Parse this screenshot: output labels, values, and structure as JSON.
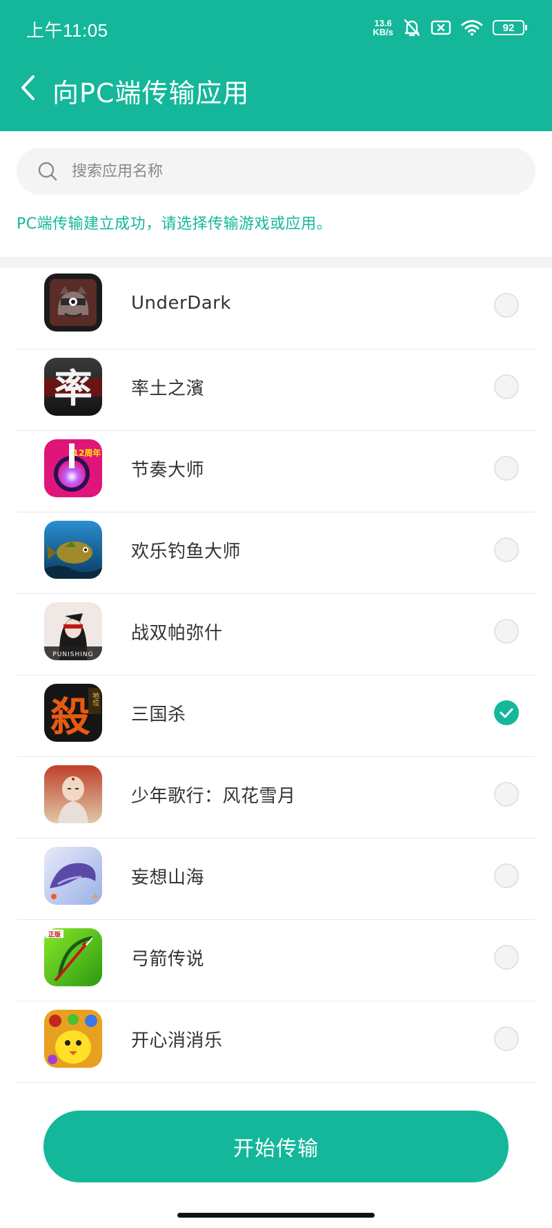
{
  "status": {
    "time": "上午11:05",
    "net_speed_value": "13.6",
    "net_speed_unit": "KB/s",
    "battery": "92"
  },
  "header": {
    "title": "向PC端传输应用"
  },
  "search": {
    "placeholder": "搜索应用名称"
  },
  "notice": "PC端传输建立成功，请选择传输游戏或应用。",
  "apps": [
    {
      "name": "UnderDark",
      "selected": false,
      "icon": "underdark-icon"
    },
    {
      "name": "率土之濱",
      "selected": false,
      "icon": "shuaitu-icon"
    },
    {
      "name": "节奏大师",
      "selected": false,
      "icon": "rhythm-master-icon"
    },
    {
      "name": "欢乐钓鱼大师",
      "selected": false,
      "icon": "fishing-icon"
    },
    {
      "name": "战双帕弥什",
      "selected": false,
      "icon": "punishing-icon"
    },
    {
      "name": "三国杀",
      "selected": true,
      "icon": "sanguosha-icon"
    },
    {
      "name": "少年歌行：风花雪月",
      "selected": false,
      "icon": "shaonian-icon"
    },
    {
      "name": "妄想山海",
      "selected": false,
      "icon": "wangxiang-icon"
    },
    {
      "name": "弓箭传说",
      "selected": false,
      "icon": "archero-icon"
    },
    {
      "name": "开心消消乐",
      "selected": false,
      "icon": "happy-match-icon"
    }
  ],
  "icon_text": {
    "shuaitu": "率",
    "sanguosha": "殺",
    "sanguosha_tag": "地位",
    "archero_tag": "正版",
    "rhythm_tag": "12周年",
    "punishing": "PUNISHING"
  },
  "button": {
    "start": "开始传输"
  },
  "colors": {
    "accent": "#14b79a"
  }
}
